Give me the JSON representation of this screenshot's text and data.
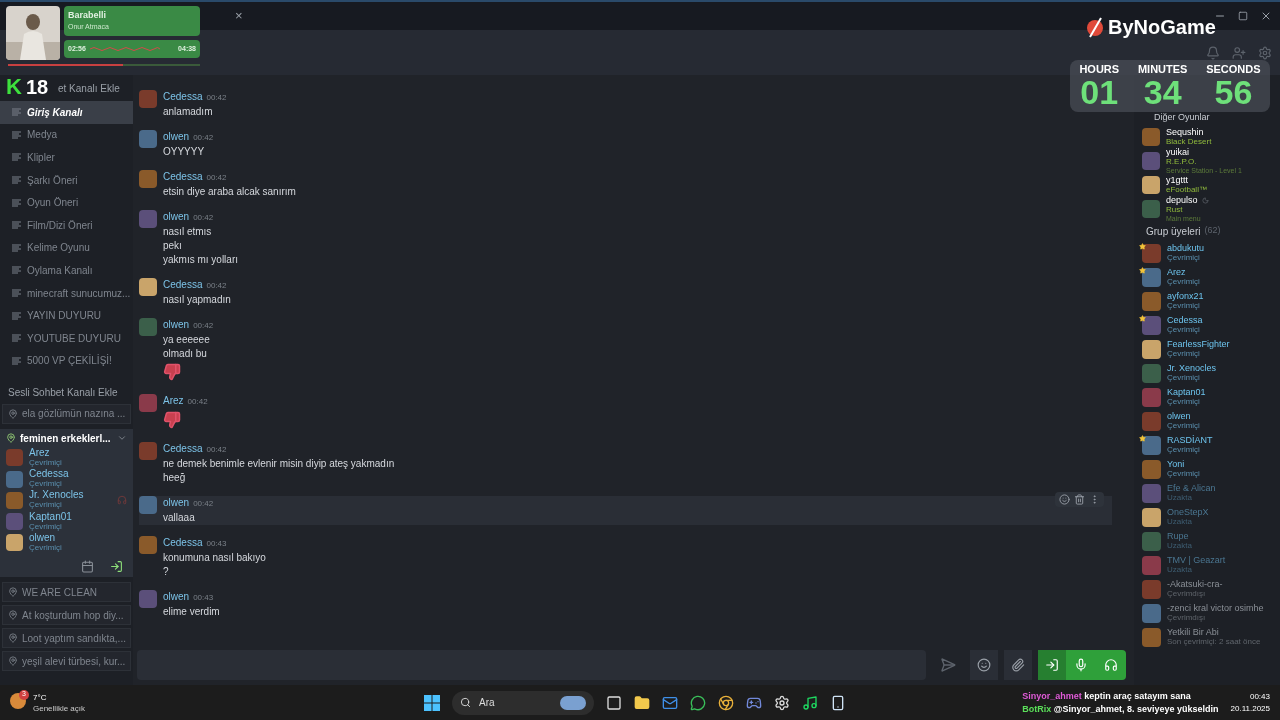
{
  "music": {
    "title": "Barabelli",
    "artist": "Onur Atmaca",
    "elapsed": "02:56",
    "total": "04:38",
    "level": 0.6
  },
  "logo18": {
    "letter": "K",
    "number": "18"
  },
  "brand": "ByNoGame",
  "timer": [
    {
      "label": "HOURS",
      "value": "01"
    },
    {
      "label": "MINUTES",
      "value": "34"
    },
    {
      "label": "SECONDS",
      "value": "56"
    }
  ],
  "tab_close": "×",
  "sidebar": {
    "add_text_channel": "et Kanalı Ekle",
    "text_channels": [
      {
        "name": "Giriş Kanalı",
        "selected": true
      },
      {
        "name": "Medya",
        "selected": false
      },
      {
        "name": "Klipler",
        "selected": false
      },
      {
        "name": "Şarkı Öneri",
        "selected": false
      },
      {
        "name": "Oyun Öneri",
        "selected": false
      },
      {
        "name": "Film/Dizi Öneri",
        "selected": false
      },
      {
        "name": "Kelime Oyunu",
        "selected": false
      },
      {
        "name": "Oylama Kanalı",
        "selected": false
      },
      {
        "name": "minecraft sunucumuz...",
        "selected": false
      },
      {
        "name": "YAYIN DUYURU",
        "selected": false
      },
      {
        "name": "YOUTUBE DUYURU",
        "selected": false
      },
      {
        "name": "5000 VP ÇEKİLİŞİ!",
        "selected": false
      }
    ],
    "add_voice_channel": "Sesli Sohbet Kanalı Ekle",
    "voice_channels": [
      {
        "name": "ela gözlümün nazına ...",
        "expanded": false
      },
      {
        "name": "feminen erkeklerl...",
        "expanded": true,
        "members": [
          {
            "name": "Arez",
            "status": "Çevrimiçi",
            "muted": false
          },
          {
            "name": "Cedessa",
            "status": "Çevrimiçi",
            "muted": false
          },
          {
            "name": "Jr. Xenocles",
            "status": "Çevrimiçi",
            "muted": true
          },
          {
            "name": "Kaptan01",
            "status": "Çevrimiçi",
            "muted": false
          },
          {
            "name": "olwen",
            "status": "Çevrimiçi",
            "muted": false
          }
        ]
      },
      {
        "name": "WE ARE CLEAN",
        "expanded": false
      },
      {
        "name": "At koşturdum hop diy...",
        "expanded": false
      },
      {
        "name": "Loot yaptım sandıkta,...",
        "expanded": false
      },
      {
        "name": "yeşil alevi türbesi, kur...",
        "expanded": false
      }
    ]
  },
  "messages": [
    {
      "author": "Cedessa",
      "time": "00:42",
      "hovered": false,
      "lines": [
        {
          "kind": "text",
          "text": "anlamadım"
        }
      ]
    },
    {
      "author": "olwen",
      "time": "00:42",
      "hovered": false,
      "lines": [
        {
          "kind": "text",
          "text": "OYYYYY"
        }
      ]
    },
    {
      "author": "Cedessa",
      "time": "00:42",
      "hovered": false,
      "lines": [
        {
          "kind": "text",
          "text": "etsin diye araba alcak sanırım"
        }
      ]
    },
    {
      "author": "olwen",
      "time": "00:42",
      "hovered": false,
      "lines": [
        {
          "kind": "text",
          "text": "nasıl etmıs"
        },
        {
          "kind": "text",
          "text": "pekı"
        },
        {
          "kind": "text",
          "text": "yakmıs mı yolları"
        }
      ]
    },
    {
      "author": "Cedessa",
      "time": "00:42",
      "hovered": false,
      "lines": [
        {
          "kind": "text",
          "text": "nasıl yapmadın"
        }
      ]
    },
    {
      "author": "olwen",
      "time": "00:42",
      "hovered": false,
      "lines": [
        {
          "kind": "text",
          "text": "ya eeeeee"
        },
        {
          "kind": "text",
          "text": "olmadı bu"
        },
        {
          "kind": "thumbs_down"
        }
      ]
    },
    {
      "author": "Arez",
      "time": "00:42",
      "hovered": false,
      "lines": [
        {
          "kind": "thumbs_down"
        }
      ]
    },
    {
      "author": "Cedessa",
      "time": "00:42",
      "hovered": false,
      "lines": [
        {
          "kind": "text",
          "text": "ne demek benimle evlenir misin diyip ateş yakmadın"
        },
        {
          "kind": "text",
          "text": "heeğ"
        }
      ]
    },
    {
      "author": "olwen",
      "time": "00:42",
      "hovered": true,
      "lines": [
        {
          "kind": "text",
          "text": "vallaaa"
        }
      ]
    },
    {
      "author": "Cedessa",
      "time": "00:43",
      "hovered": false,
      "lines": [
        {
          "kind": "text",
          "text": "konumuna nasıl bakıyo"
        },
        {
          "kind": "text",
          "text": "?"
        }
      ]
    },
    {
      "author": "olwen",
      "time": "00:43",
      "hovered": false,
      "lines": [
        {
          "kind": "text",
          "text": "elime verdim"
        }
      ]
    }
  ],
  "members_panel": {
    "other_games": "Diğer Oyunlar",
    "playing": [
      {
        "name": "Sequshin",
        "game": "Black Desert"
      },
      {
        "name": "yuikai",
        "game": "R.E.P.O.",
        "detail": "Service Station - Level 1"
      },
      {
        "name": "y1gttt",
        "game": "eFootball™"
      },
      {
        "name": "depulso",
        "game": "Rust",
        "detail": "Main menu",
        "idle": true
      }
    ],
    "group_title": "Grup üyeleri",
    "group_count": "(62)",
    "members": [
      {
        "name": "abdukutu",
        "status": "Çevrimiçi",
        "kind": "online",
        "starred": true
      },
      {
        "name": "Arez",
        "status": "Çevrimiçi",
        "kind": "online",
        "starred": true
      },
      {
        "name": "ayfonx21",
        "status": "Çevrimiçi",
        "kind": "online",
        "starred": false
      },
      {
        "name": "Cedessa",
        "status": "Çevrimiçi",
        "kind": "online",
        "starred": true
      },
      {
        "name": "FearlessFighter",
        "status": "Çevrimiçi",
        "kind": "online",
        "starred": false
      },
      {
        "name": "Jr. Xenocles",
        "status": "Çevrimiçi",
        "kind": "online",
        "starred": false
      },
      {
        "name": "Kaptan01",
        "status": "Çevrimiçi",
        "kind": "online",
        "starred": false
      },
      {
        "name": "olwen",
        "status": "Çevrimiçi",
        "kind": "online",
        "starred": false
      },
      {
        "name": "RASDİANT",
        "status": "Çevrimiçi",
        "kind": "online",
        "starred": true
      },
      {
        "name": "Yoni",
        "status": "Çevrimiçi",
        "kind": "online",
        "starred": false
      },
      {
        "name": "Efe & Alican",
        "status": "Uzakta",
        "kind": "away",
        "starred": false
      },
      {
        "name": "OneStepX",
        "status": "Uzakta",
        "kind": "away",
        "starred": false
      },
      {
        "name": "Rupe",
        "status": "Uzakta",
        "kind": "away",
        "starred": false
      },
      {
        "name": "TMV | Geazart",
        "status": "Uzakta",
        "kind": "away",
        "starred": false
      },
      {
        "name": "-Akatsuki-cra-",
        "status": "Çevrimdışı",
        "kind": "offline",
        "starred": false
      },
      {
        "name": "-zenci kral victor osimhe",
        "status": "Çevrimdışı",
        "kind": "offline",
        "starred": false
      },
      {
        "name": "Yetkili Bir Abi",
        "status": "Son çevrimiçi: 2 saat önce",
        "kind": "offline",
        "starred": false
      }
    ]
  },
  "taskbar": {
    "temperature": "7°C",
    "weather": "Genellikle açık",
    "weather_badge": "3",
    "search": "Ara",
    "chat": [
      {
        "user": "Sinyor_ahmet",
        "text": "keptin araç satayım sana",
        "color": "#e05ad8"
      },
      {
        "user": "BotRix",
        "text": "@Sinyor_ahmet, 8. seviyeye yükseldin",
        "color": "#5be05a"
      }
    ],
    "time": "00:43",
    "date": "20.11.2025"
  }
}
